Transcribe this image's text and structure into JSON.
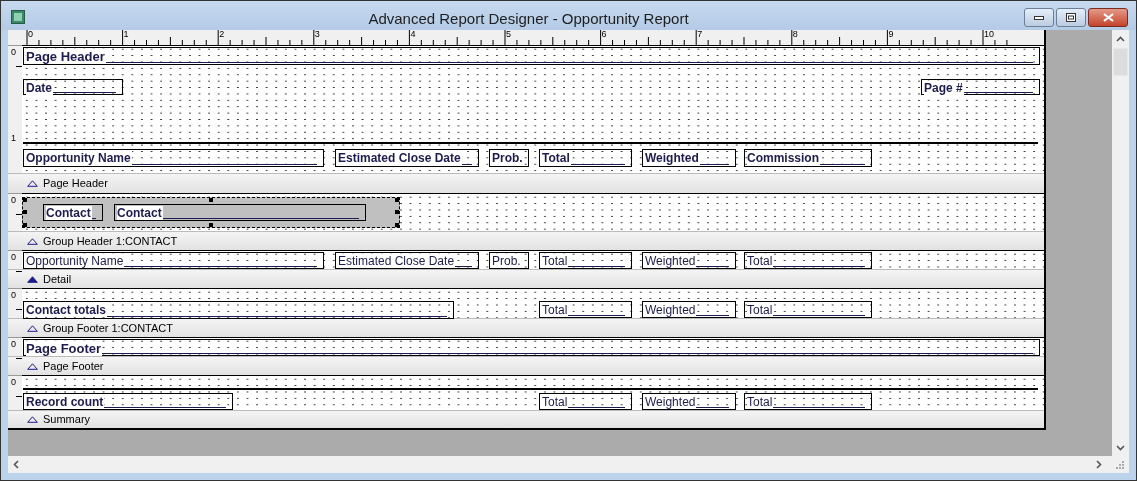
{
  "window": {
    "title": "Advanced Report Designer - Opportunity Report"
  },
  "ruler": {
    "numbers": [
      "0",
      "1",
      "2",
      "3",
      "4",
      "5",
      "6",
      "7",
      "8",
      "9",
      "10"
    ]
  },
  "sections": [
    {
      "ruler_labels": [
        "0",
        "1"
      ],
      "fields": [
        {
          "kind": "heading",
          "text": "Page Header"
        },
        {
          "kind": "label",
          "text": "Date"
        },
        {
          "kind": "label",
          "text": "Page #"
        },
        {
          "kind": "label",
          "text": "Opportunity Name"
        },
        {
          "kind": "label",
          "text": "Estimated Close Date"
        },
        {
          "kind": "label",
          "text": "Prob."
        },
        {
          "kind": "label",
          "text": "Total"
        },
        {
          "kind": "label",
          "text": "Weighted"
        },
        {
          "kind": "label",
          "text": "Commission"
        }
      ],
      "bar": {
        "label": "Page Header",
        "selected": false
      }
    },
    {
      "ruler_labels": [
        "0"
      ],
      "frame": {
        "selected": true
      },
      "fields": [
        {
          "kind": "label",
          "text": "Contact"
        },
        {
          "kind": "label",
          "text": "Contact"
        }
      ],
      "bar": {
        "label": "Group Header 1:CONTACT",
        "selected": false
      }
    },
    {
      "ruler_labels": [
        "0"
      ],
      "fields": [
        {
          "kind": "field",
          "text": "Opportunity Name"
        },
        {
          "kind": "field",
          "text": "Estimated Close Date"
        },
        {
          "kind": "field",
          "text": "Prob."
        },
        {
          "kind": "field",
          "text": "Total"
        },
        {
          "kind": "field",
          "text": "Weighted"
        },
        {
          "kind": "field",
          "text": "Total"
        }
      ],
      "bar": {
        "label": "Detail",
        "selected": true
      }
    },
    {
      "ruler_labels": [
        "0"
      ],
      "fields": [
        {
          "kind": "label",
          "text": "Contact totals"
        },
        {
          "kind": "field",
          "text": "Total"
        },
        {
          "kind": "field",
          "text": "Weighted"
        },
        {
          "kind": "field",
          "text": "Total"
        }
      ],
      "bar": {
        "label": "Group Footer 1:CONTACT",
        "selected": false
      }
    },
    {
      "ruler_labels": [
        "0"
      ],
      "fields": [
        {
          "kind": "heading",
          "text": "Page Footer"
        }
      ],
      "bar": {
        "label": "Page Footer",
        "selected": false
      }
    },
    {
      "ruler_labels": [
        "0"
      ],
      "fields": [
        {
          "kind": "label",
          "text": "Record count"
        },
        {
          "kind": "field",
          "text": "Total"
        },
        {
          "kind": "field",
          "text": "Weighted"
        },
        {
          "kind": "field",
          "text": "Total"
        }
      ],
      "bar": {
        "label": "Summary",
        "selected": false
      }
    }
  ]
}
